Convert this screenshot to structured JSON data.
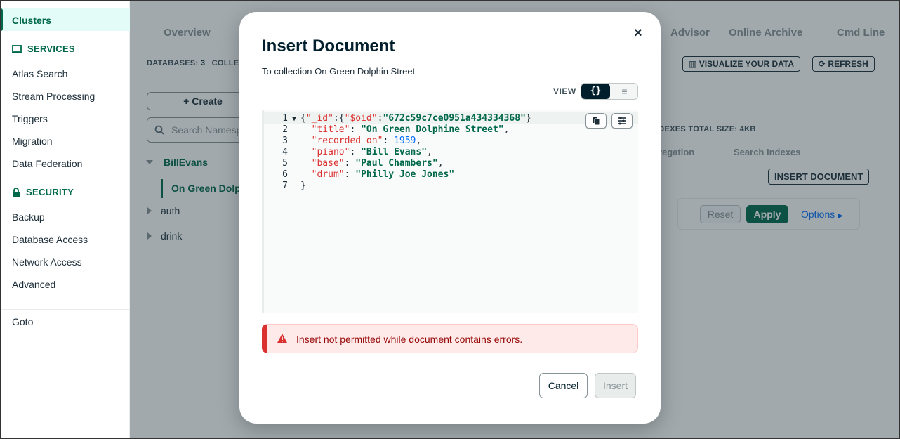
{
  "sidebar": {
    "active": "Clusters",
    "services_header": "SERVICES",
    "services": [
      "Atlas Search",
      "Stream Processing",
      "Triggers",
      "Migration",
      "Data Federation"
    ],
    "security_header": "SECURITY",
    "security": [
      "Backup",
      "Database Access",
      "Network Access",
      "Advanced"
    ],
    "goto": "Goto"
  },
  "main": {
    "tabs": [
      "Overview",
      "Advisor",
      "Online Archive",
      "Cmd Line"
    ],
    "stats": {
      "databases_label": "DATABASES:",
      "databases_count": "3",
      "collections_label": "COLLEC"
    },
    "visualize_btn": "VISUALIZE YOUR DATA",
    "refresh_btn": "REFRESH",
    "create_btn": "+ Create",
    "search_placeholder": "Search Namesp",
    "databases": [
      {
        "name": "BillEvans",
        "expanded": true,
        "collections": [
          "On Green Dolp"
        ]
      },
      {
        "name": "auth"
      },
      {
        "name": "drink"
      }
    ],
    "indexes_size": "NDEXES TOTAL SIZE: 4KB",
    "subtabs": [
      "gregation",
      "Search Indexes"
    ],
    "insert_document_btn": "INSERT DOCUMENT",
    "reset_btn": "Reset",
    "apply_btn": "Apply",
    "options_link": "Options"
  },
  "modal": {
    "title": "Insert Document",
    "subtitle": "To collection On Green Dolphin Street",
    "view_label": "VIEW",
    "view_json_glyph": "{}",
    "view_list_glyph": "≡",
    "code": {
      "line_numbers": [
        "1",
        "2",
        "3",
        "4",
        "5",
        "6",
        "7"
      ],
      "oid_key": "\"_id\"",
      "oid_op": "\"$oid\"",
      "oid_value": "\"672c59c7ce0951a434334368\"",
      "fields": [
        {
          "key": "\"title\"",
          "value": "\"On Green Dolphine Street\"",
          "type": "string"
        },
        {
          "key": "\"recorded on\"",
          "value": "1959",
          "type": "number"
        },
        {
          "key": "\"piano\"",
          "value": "\"Bill Evans\"",
          "type": "string"
        },
        {
          "key": "\"base\"",
          "value": "\"Paul Chambers\"",
          "type": "string"
        },
        {
          "key": "\"drum\"",
          "value": "\"Philly Joe Jones\"",
          "type": "string"
        }
      ]
    },
    "error": "Insert not permitted while document contains errors.",
    "cancel_btn": "Cancel",
    "insert_btn": "Insert"
  },
  "colors": {
    "accent": "#00684a",
    "error": "#db3030",
    "error_bg": "#ffeaea",
    "dark": "#001e2b",
    "link": "#016bf8"
  }
}
